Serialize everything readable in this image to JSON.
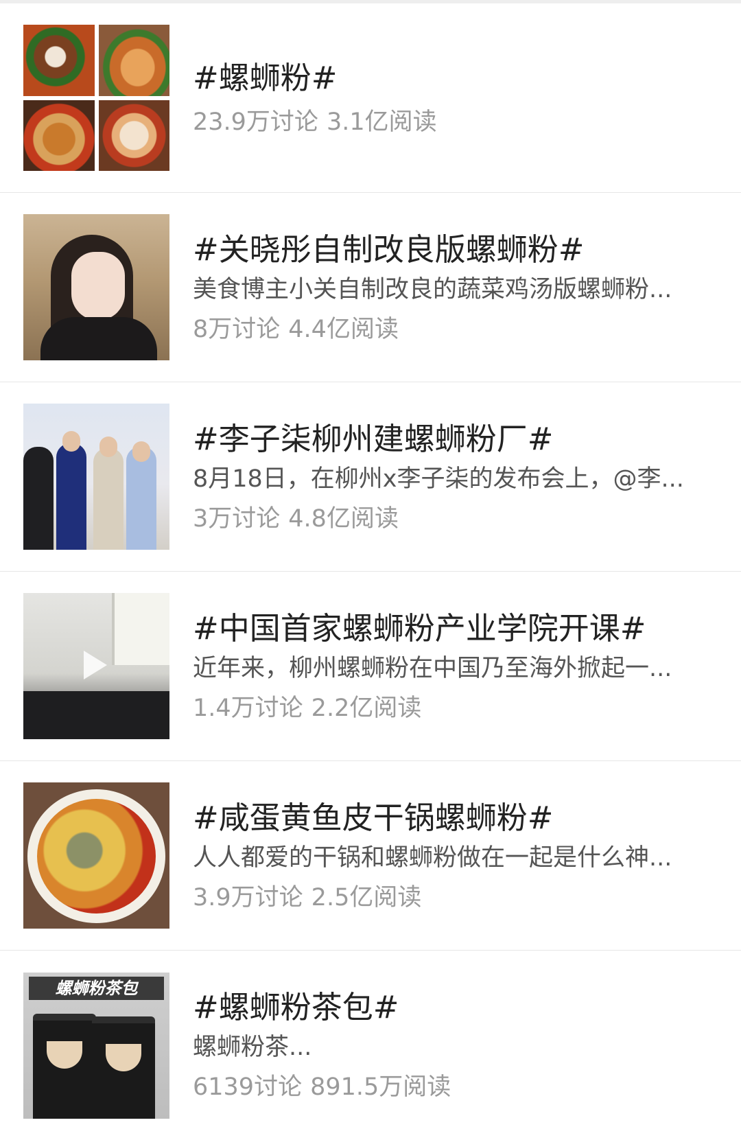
{
  "topics": [
    {
      "title": "#螺蛳粉#",
      "description": "",
      "discussions": "23.9万讨论",
      "reads": "3.1亿阅读",
      "thumbnail_icon": "food-collage-image"
    },
    {
      "title": "#关晓彤自制改良版螺蛳粉#",
      "description": "美食博主小关自制改良的蔬菜鸡汤版螺蛳粉...",
      "discussions": "8万讨论",
      "reads": "4.4亿阅读",
      "thumbnail_icon": "portrait-image"
    },
    {
      "title": "#李子柒柳州建螺蛳粉厂#",
      "description": "8月18日，在柳州x李子柒的发布会上，@李...",
      "discussions": "3万讨论",
      "reads": "4.8亿阅读",
      "thumbnail_icon": "press-event-image"
    },
    {
      "title": "#中国首家螺蛳粉产业学院开课#",
      "description": "近年来，柳州螺蛳粉在中国乃至海外掀起一...",
      "discussions": "1.4万讨论",
      "reads": "2.2亿阅读",
      "thumbnail_icon": "video-play-icon"
    },
    {
      "title": "#咸蛋黄鱼皮干锅螺蛳粉#",
      "description": "人人都爱的干锅和螺蛳粉做在一起是什么神...",
      "discussions": "3.9万讨论",
      "reads": "2.5亿阅读",
      "thumbnail_icon": "noodle-bowl-image"
    },
    {
      "title": "#螺蛳粉茶包#",
      "description": "螺蛳粉茶...",
      "discussions": "6139讨论",
      "reads": "891.5万阅读",
      "thumbnail_icon": "tea-pack-image",
      "thumbnail_text": "螺蛳粉茶包"
    }
  ],
  "colors": {
    "title": "#222222",
    "description": "#555555",
    "stats": "#9a9a9a",
    "divider": "#e6e6e6"
  }
}
